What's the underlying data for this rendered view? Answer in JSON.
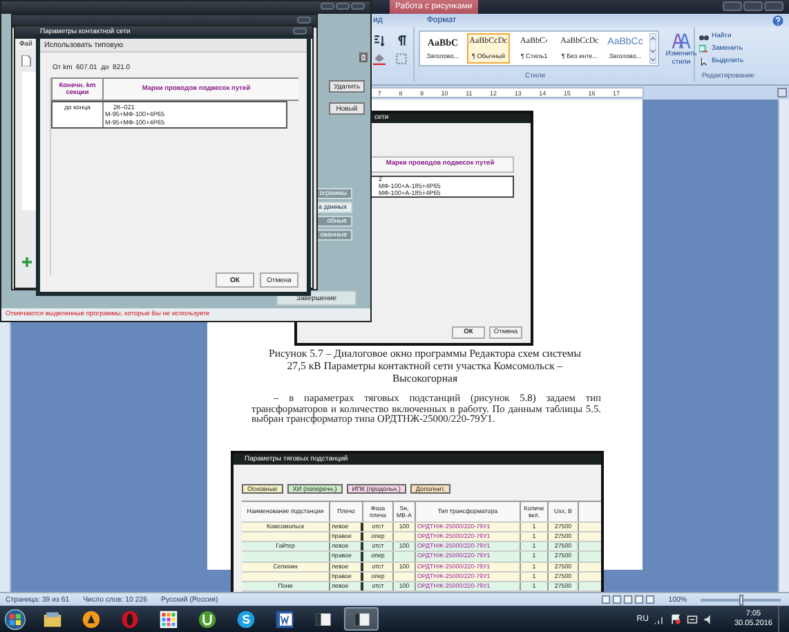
{
  "word": {
    "contextual_tab": "Работа с рисунками",
    "tabs": [
      {
        "label": "ид",
        "selected": false
      },
      {
        "label": "Формат",
        "selected": false
      }
    ],
    "styles": [
      {
        "preview": "AaBbC",
        "name": "Заголово...",
        "kind": "heading",
        "selected": false
      },
      {
        "preview": "AaBbCcDc",
        "name": "¶ Обычный",
        "kind": "normal",
        "selected": true
      },
      {
        "preview": "AaBbC‹",
        "name": "¶ Стиль1",
        "kind": "normal",
        "selected": false
      },
      {
        "preview": "AaBbCcDc",
        "name": "¶ Без инте...",
        "kind": "normal",
        "selected": false
      },
      {
        "preview": "AaBbCc",
        "name": "Заголово...",
        "kind": "title",
        "selected": false
      }
    ],
    "change_styles": "Изменить стили",
    "editing": [
      {
        "label": "Найти",
        "kind": "find"
      },
      {
        "label": "Заменить",
        "kind": "replace"
      },
      {
        "label": "Выделить",
        "kind": "select"
      }
    ],
    "group_labels": [
      "Стили",
      "Редактирование"
    ],
    "ruler": [
      "7",
      "8",
      "9",
      "10",
      "11",
      "12",
      "13",
      "14",
      "15",
      "16",
      "17"
    ]
  },
  "back_window": {
    "menu": "Фай",
    "title": "Параметры контактной сети",
    "buttons": [
      {
        "label": "Удалить",
        "selected": false
      },
      {
        "label": "Новый",
        "selected": false
      }
    ],
    "side_buttons": [
      {
        "label": "ограммы",
        "selected": false
      },
      {
        "label": "а данных",
        "selected": true
      },
      {
        "label": "обные",
        "selected": false
      },
      {
        "label": "ованные",
        "selected": false
      }
    ],
    "finish_button": "Завершение",
    "status_text": "Отмечаются выделенные программы, которые Вы не используете"
  },
  "dialog": {
    "title": "Использовать типовую",
    "range": "От km  607.01  до  821.0",
    "columns": [
      "Конечн. km секции",
      "Марки проводов подвесок путей"
    ],
    "rows": [
      {
        "end": "до конца",
        "wires": [
          "2К–021",
          "М-95+МФ-100+4Р65",
          "М-95+МФ-100+4Р65"
        ]
      }
    ],
    "buttons": [
      "ОК",
      "Отмена"
    ]
  },
  "document": {
    "figure_dialog": {
      "title": "сети",
      "column": "Марки проводов подвесок путей",
      "lines": [
        "2",
        "МФ-100+А-185+4Р65",
        "МФ-100+А-185+4Р65"
      ],
      "buttons": [
        "ОК",
        "Отмена"
      ]
    },
    "caption": [
      "Рисунок 5.7 – Диалоговое окно программы Редактора схем системы",
      "27,5 кВ Параметры контактной сети участка Комсомольск –",
      "Высокогорная"
    ],
    "paragraph": "– в параметрах тяговых подстанций (рисунок 5.8) задаем тип трансформаторов и количество включенных в работу. По данным таблицы 5.5. выбран трансформатор типа ОРДТНЖ-25000/220-79У1.",
    "figure_table": {
      "title": "Параметры тяговых подстанций",
      "tabs": [
        {
          "label": "Основные",
          "color": "#f3efc4"
        },
        {
          "label": "ХИ (поперечн.)",
          "color": "#cdebc9"
        },
        {
          "label": "ИПК (продольн.)",
          "color": "#f6d3e6"
        },
        {
          "label": "Дополнит.",
          "color": "#f7e0bf"
        }
      ],
      "columns": [
        "Наименование подстанции",
        "Плечо",
        "Фаза плеча",
        "Sн, МВ·А",
        "Тип трансформатора",
        "Количе вкл.",
        "Uхх, В"
      ],
      "rows": [
        {
          "color": "#fbf8dc",
          "cells": [
            "Комсомольск",
            "левое",
            "отст",
            "100",
            "ОРДТНЖ-25000/220-79У1",
            "1",
            "27500"
          ]
        },
        {
          "color": "#fbf8dc",
          "cells": [
            "",
            "правое",
            "опер",
            "",
            "ОРДТНЖ-25000/220-79У1",
            "1",
            "27500"
          ]
        },
        {
          "color": "#dff5e6",
          "cells": [
            "Гайтер",
            "левое",
            "отст",
            "100",
            "ОРДТНЖ-25000/220-79У1",
            "1",
            "27500"
          ]
        },
        {
          "color": "#dff5e6",
          "cells": [
            "",
            "правое",
            "опер",
            "",
            "ОРДТНЖ-25000/220-79У1",
            "1",
            "27500"
          ]
        },
        {
          "color": "#fbf8dc",
          "cells": [
            "Селихин",
            "левое",
            "отст",
            "100",
            "ОРДТНЖ-25000/220-79У1",
            "1",
            "27500"
          ]
        },
        {
          "color": "#fbf8dc",
          "cells": [
            "",
            "правое",
            "опер",
            "",
            "ОРДТНЖ-25000/220-79У1",
            "1",
            "27500"
          ]
        },
        {
          "color": "#dff5e6",
          "cells": [
            "Пони",
            "левое",
            "отст",
            "100",
            "ОРДТНЖ-25000/220-79У1",
            "1",
            "27500"
          ]
        }
      ]
    }
  },
  "status_bar": {
    "items": [
      "Страница: 39 из 61",
      "Число слов: 10 226",
      "Русский (Россия)"
    ],
    "zoom": "100%",
    "zoom_slider": {
      "level": 0.5
    }
  },
  "taskbar": {
    "apps": [
      {
        "kind": "explorer",
        "selected": false
      },
      {
        "kind": "aimp",
        "selected": false
      },
      {
        "kind": "opera",
        "selected": false
      },
      {
        "kind": "grid",
        "selected": false
      },
      {
        "kind": "torrent",
        "selected": false
      },
      {
        "kind": "skype",
        "selected": false
      },
      {
        "kind": "word",
        "selected": false
      },
      {
        "kind": "window",
        "selected": false
      },
      {
        "kind": "window",
        "selected": true
      }
    ],
    "language": "RU",
    "time": "7:05",
    "date": "30.05.2016"
  }
}
